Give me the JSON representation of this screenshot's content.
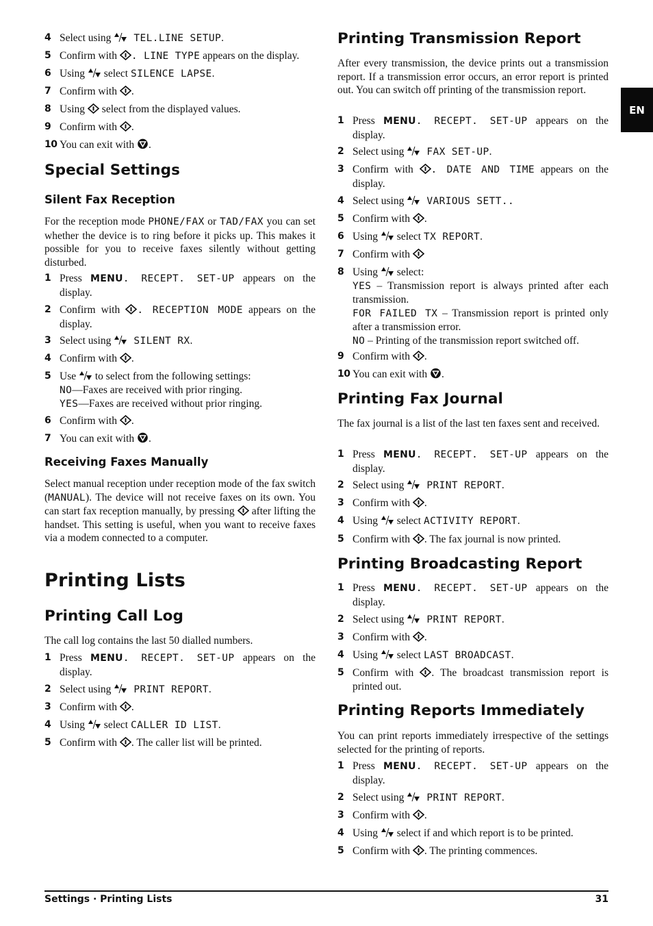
{
  "tab": {
    "language": "EN"
  },
  "footer": {
    "section": "Settings · Printing Lists",
    "page": "31"
  },
  "icons": {
    "updown": "up-down-arrows",
    "ok": "ok-start-diamond",
    "stop": "stop-button"
  },
  "left": {
    "intro_steps": [
      {
        "n": "4",
        "a": "Select using ",
        "icon": "updown",
        "lcd": " TEL.LINE SETUP",
        "b": "."
      },
      {
        "n": "5",
        "a": "Confirm with ",
        "icon": "ok",
        "lcd": ". LINE TYPE",
        "b": " appears on the display."
      },
      {
        "n": "6",
        "a": "Using ",
        "icon": "updown",
        "b1": " select ",
        "lcd": "SILENCE LAPSE",
        "b": "."
      },
      {
        "n": "7",
        "a": "Confirm with ",
        "icon": "ok",
        "b": "."
      },
      {
        "n": "8",
        "a": "Using ",
        "icon": "ok",
        "b": " select from the displayed values."
      },
      {
        "n": "9",
        "a": "Confirm with ",
        "icon": "ok",
        "b": "."
      },
      {
        "n": "10",
        "a": "You can exit with ",
        "icon": "stop",
        "b": "."
      }
    ],
    "special_settings": {
      "heading": "Special Settings",
      "silent": {
        "heading": "Silent Fax Reception",
        "para_a": "For the reception mode ",
        "para_lcd1": "PHONE/FAX",
        "para_b": " or ",
        "para_lcd2": "TAD/FAX",
        "para_c": " you can set whether the device is to ring before it picks up. This makes it possible for you to receive faxes silently without getting disturbed.",
        "steps": [
          {
            "n": "1",
            "a": "Press ",
            "bold": "MENU",
            "lcd": ". RECEPT.  SET-UP",
            "b": " appears on the display."
          },
          {
            "n": "2",
            "a": "Confirm with ",
            "icon": "ok",
            "lcd": ". RECEPTION MODE",
            "b": " appears on the display."
          },
          {
            "n": "3",
            "a": "Select using ",
            "icon": "updown",
            "lcd": " SILENT RX",
            "b": "."
          },
          {
            "n": "4",
            "a": "Confirm with ",
            "icon": "ok",
            "b": "."
          },
          {
            "n": "5",
            "a": "Use ",
            "icon": "updown",
            "b": " to select from the following settings:",
            "options": [
              {
                "lcd": "NO",
                "text": "—Faxes are received with prior ringing."
              },
              {
                "lcd": "YES",
                "text": "—Faxes are received without prior ringing."
              }
            ]
          },
          {
            "n": "6",
            "a": "Confirm with ",
            "icon": "ok",
            "b": "."
          },
          {
            "n": "7",
            "a": "You can exit with ",
            "icon": "stop",
            "b": "."
          }
        ]
      },
      "manual": {
        "heading": "Receiving Faxes Manually",
        "para_a": "Select manual reception under reception mode of the fax switch (",
        "para_lcd": "MANUAL",
        "para_b": "). The device will not receive faxes on its own. You can start fax reception manually, by pressing ",
        "para_c": " after lifting the handset. This setting is useful, when you want to receive faxes via a modem connected to a computer."
      }
    },
    "printing_lists": {
      "heading": "Printing Lists",
      "call_log": {
        "heading": "Printing Call Log",
        "para": "The call log contains the last 50 dialled numbers.",
        "steps": [
          {
            "n": "1",
            "a": "Press ",
            "bold": "MENU",
            "lcd": ". RECEPT.  SET-UP",
            "b": " appears on the display."
          },
          {
            "n": "2",
            "a": "Select using ",
            "icon": "updown",
            "lcd": " PRINT REPORT",
            "b": "."
          },
          {
            "n": "3",
            "a": "Confirm with ",
            "icon": "ok",
            "b": "."
          },
          {
            "n": "4",
            "a": "Using ",
            "icon": "updown",
            "b1": " select ",
            "lcd": "CALLER ID LIST",
            "b": "."
          },
          {
            "n": "5",
            "a": "Confirm with ",
            "icon": "ok",
            "b": ". The caller list will be printed."
          }
        ]
      }
    }
  },
  "right": {
    "transmission": {
      "heading": "Printing Transmission Report",
      "para": "After every transmission, the device prints out a transmission report. If a transmission error occurs, an error report is printed out. You can switch off printing of the transmission report.",
      "steps": [
        {
          "n": "1",
          "a": "Press ",
          "bold": "MENU",
          "lcd": ". RECEPT.  SET-UP",
          "b": " appears on the display."
        },
        {
          "n": "2",
          "a": "Select using ",
          "icon": "updown",
          "lcd": " FAX SET-UP",
          "b": "."
        },
        {
          "n": "3",
          "a": "Confirm with ",
          "icon": "ok",
          "lcd": ". DATE AND TIME",
          "b": " appears on the display."
        },
        {
          "n": "4",
          "a": "Select using ",
          "icon": "updown",
          "lcd": " VARIOUS SETT..",
          "b": ""
        },
        {
          "n": "5",
          "a": "Confirm with ",
          "icon": "ok",
          "b": "."
        },
        {
          "n": "6",
          "a": "Using ",
          "icon": "updown",
          "b1": " select ",
          "lcd": "TX REPORT",
          "b": "."
        },
        {
          "n": "7",
          "a": "Confirm with ",
          "icon": "ok",
          "b": ""
        },
        {
          "n": "8",
          "a": "Using ",
          "icon": "updown",
          "b": " select:",
          "options": [
            {
              "lcd": "YES",
              "text": " – Transmission report is always printed after each transmission."
            },
            {
              "lcd": "FOR FAILED TX",
              "text": " – Transmission report is printed only after a transmission error."
            },
            {
              "lcd": "NO",
              "text": " – Printing of the transmission report switched off."
            }
          ]
        },
        {
          "n": "9",
          "a": "Confirm with ",
          "icon": "ok",
          "b": "."
        },
        {
          "n": "10",
          "a": "You can exit with ",
          "icon": "stop",
          "b": "."
        }
      ]
    },
    "fax_journal": {
      "heading": "Printing Fax Journal",
      "para": "The fax journal is a list of the last ten faxes sent and received.",
      "steps": [
        {
          "n": "1",
          "a": "Press ",
          "bold": "MENU",
          "lcd": ". RECEPT.  SET-UP",
          "b": " appears on the display."
        },
        {
          "n": "2",
          "a": "Select using ",
          "icon": "updown",
          "lcd": " PRINT REPORT",
          "b": "."
        },
        {
          "n": "3",
          "a": "Confirm with ",
          "icon": "ok",
          "b": "."
        },
        {
          "n": "4",
          "a": "Using ",
          "icon": "updown",
          "b1": " select ",
          "lcd": "ACTIVITY REPORT",
          "b": "."
        },
        {
          "n": "5",
          "a": "Confirm with ",
          "icon": "ok",
          "b": ". The fax journal is now printed."
        }
      ]
    },
    "broadcast": {
      "heading": "Printing Broadcasting Report",
      "steps": [
        {
          "n": "1",
          "a": "Press ",
          "bold": "MENU",
          "lcd": ". RECEPT.  SET-UP",
          "b": " appears on the display."
        },
        {
          "n": "2",
          "a": "Select using ",
          "icon": "updown",
          "lcd": " PRINT REPORT",
          "b": "."
        },
        {
          "n": "3",
          "a": "Confirm with ",
          "icon": "ok",
          "b": "."
        },
        {
          "n": "4",
          "a": "Using ",
          "icon": "updown",
          "b1": " select ",
          "lcd": "LAST BROADCAST",
          "b": "."
        },
        {
          "n": "5",
          "a": "Confirm with ",
          "icon": "ok",
          "b": ". The broadcast transmission report is printed out."
        }
      ]
    },
    "immediately": {
      "heading": "Printing Reports Immediately",
      "para": "You can print reports immediately irrespective of the settings selected for the printing of reports.",
      "steps": [
        {
          "n": "1",
          "a": "Press ",
          "bold": "MENU",
          "lcd": ". RECEPT.  SET-UP",
          "b": " appears on the display."
        },
        {
          "n": "2",
          "a": "Select using ",
          "icon": "updown",
          "lcd": " PRINT REPORT",
          "b": "."
        },
        {
          "n": "3",
          "a": "Confirm with ",
          "icon": "ok",
          "b": "."
        },
        {
          "n": "4",
          "a": "Using ",
          "icon": "updown",
          "b": " select if and which report is to be printed."
        },
        {
          "n": "5",
          "a": "Confirm with ",
          "icon": "ok",
          "b": ". The printing commences."
        }
      ]
    }
  }
}
